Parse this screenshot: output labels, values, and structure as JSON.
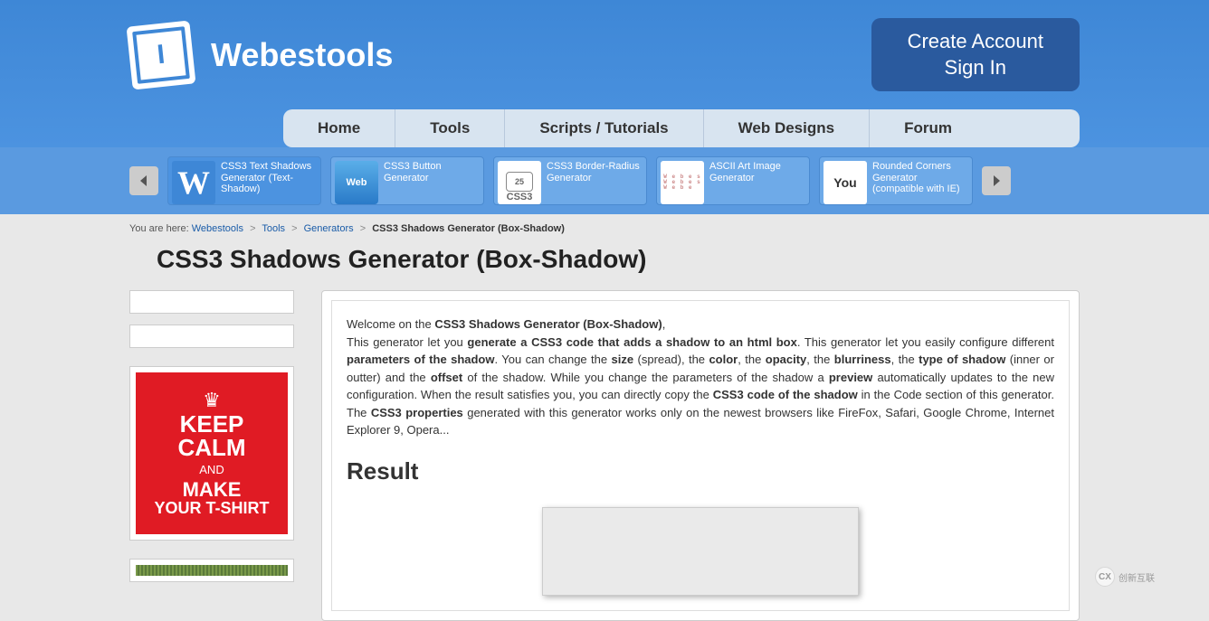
{
  "brand": "Webestools",
  "account": {
    "create": "Create Account",
    "signin": "Sign In"
  },
  "nav": {
    "home": "Home",
    "tools": "Tools",
    "scripts": "Scripts / Tutorials",
    "designs": "Web Designs",
    "forum": "Forum"
  },
  "subtools": [
    {
      "label": "CSS3 Text Shadows Generator (Text-Shadow)",
      "thumb": "W",
      "style": "w"
    },
    {
      "label": "CSS3 Button Generator",
      "thumb": "Web",
      "style": "btn"
    },
    {
      "label": "CSS3 Border-Radius Generator",
      "thumb": "CSS3",
      "style": "css3"
    },
    {
      "label": "ASCII Art Image Generator",
      "thumb": "",
      "style": "ascii"
    },
    {
      "label": "Rounded Corners Generator (compatible with IE)",
      "thumb": "You",
      "style": "you"
    }
  ],
  "breadcrumb": {
    "prefix": "You are here:",
    "items": [
      "Webestools",
      "Tools",
      "Generators"
    ],
    "current": "CSS3 Shadows Generator (Box-Shadow)"
  },
  "page_title": "CSS3 Shadows Generator (Box-Shadow)",
  "intro": {
    "t1": "Welcome on the ",
    "b1": "CSS3 Shadows Generator (Box-Shadow)",
    "t2": ",",
    "t3": "This generator let you ",
    "b3": "generate a CSS3 code that adds a shadow to an html box",
    "t4": ". This generator let you easily configure different ",
    "b4": "parameters of the shadow",
    "t5": ". You can change the ",
    "b5": "size",
    "t6": " (spread), the ",
    "b6": "color",
    "t7": ", the ",
    "b7": "opacity",
    "t8": ", the ",
    "b8": "blurriness",
    "t9": ", the ",
    "b9": "type of shadow",
    "t10": " (inner or outter) and the ",
    "b10": "offset",
    "t11": " of the shadow. While you change the parameters of the shadow a ",
    "b11": "preview",
    "t12": " automatically updates to the new configuration. When the result satisfies you, you can directly copy the ",
    "b12": "CSS3 code of the shadow",
    "t13": " in the Code section of this generator. The ",
    "b13": "CSS3 properties",
    "t14": " generated with this generator works only on the newest browsers like FireFox, Safari, Google Chrome, Internet Explorer 9, Opera..."
  },
  "result_heading": "Result",
  "ad": {
    "keep": "KEEP",
    "calm": "CALM",
    "and": "AND",
    "make": "MAKE",
    "tshirt": "YOUR T-SHIRT"
  },
  "watermark": "创新互联"
}
